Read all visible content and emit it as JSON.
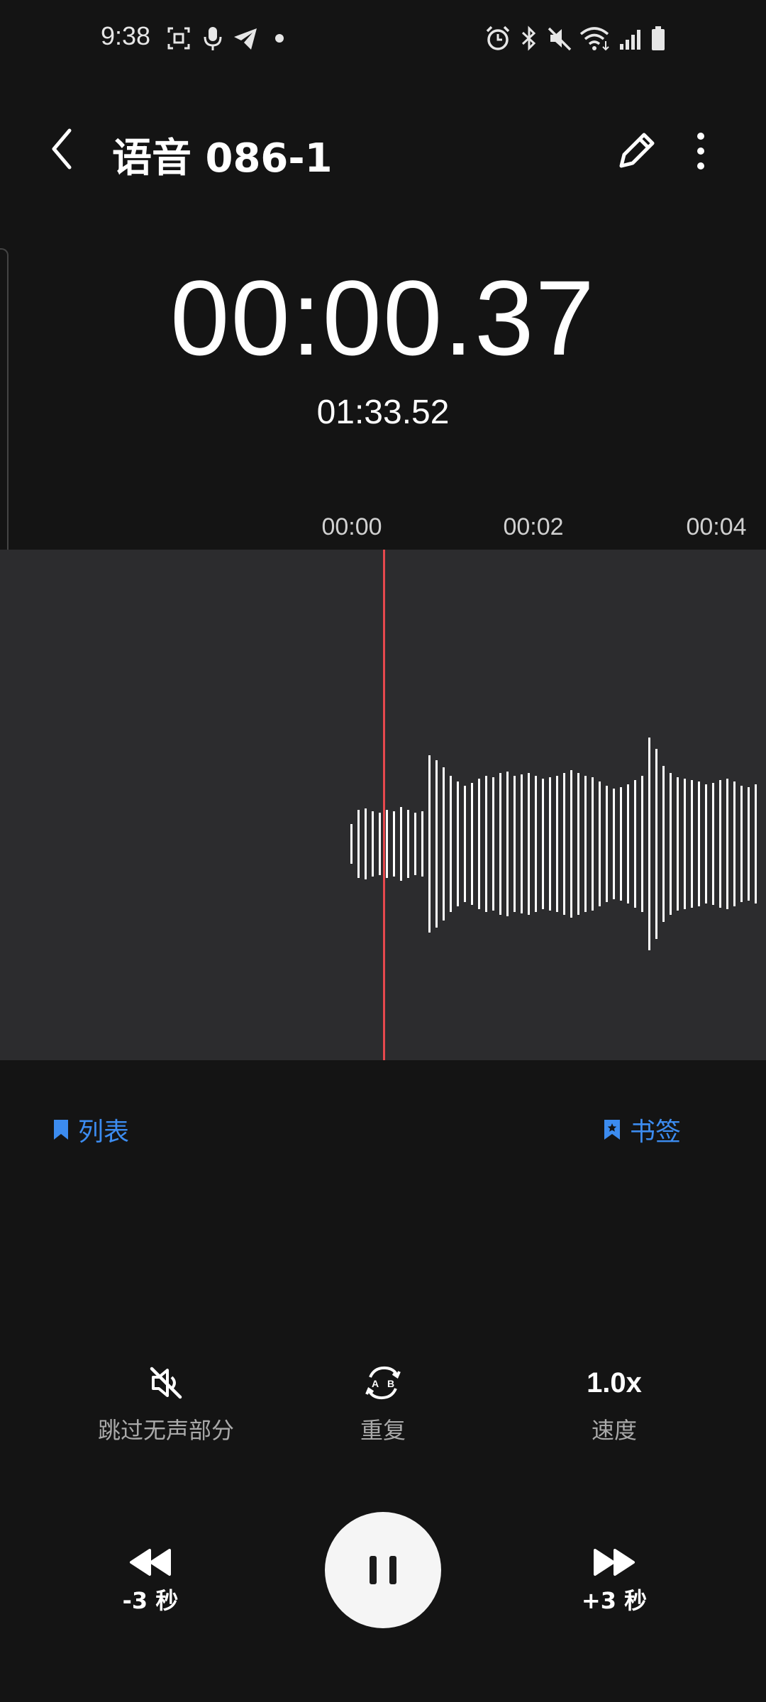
{
  "status_bar": {
    "time": "9:38",
    "left_icons": [
      "screenshot-icon",
      "mic-icon",
      "telegram-icon",
      "dot-icon"
    ],
    "right_icons": [
      "alarm-icon",
      "bluetooth-icon",
      "mute-icon",
      "wifi-icon",
      "signal-icon",
      "battery-icon"
    ]
  },
  "header": {
    "title": "语音 086-1",
    "back_icon": "chevron-left-icon",
    "edit_icon": "pencil-icon",
    "more_icon": "more-vertical-icon"
  },
  "timer": {
    "current": "00:00.37",
    "total": "01:33.52"
  },
  "timeline": {
    "labels": [
      "00:00",
      "00:02",
      "00:04"
    ]
  },
  "waveform": {
    "playhead_color": "#e5484d",
    "bar_color": "#ffffff"
  },
  "bookmarks": {
    "list_label": "列表",
    "bookmark_label": "书签",
    "accent": "#3c8cf0"
  },
  "options": {
    "skip_silence_label": "跳过无声部分",
    "repeat_label": "重复",
    "speed_value": "1.0x",
    "speed_label": "速度"
  },
  "controls": {
    "rewind_label": "-3 秒",
    "forward_label": "+3 秒",
    "play_state": "pause-icon"
  }
}
